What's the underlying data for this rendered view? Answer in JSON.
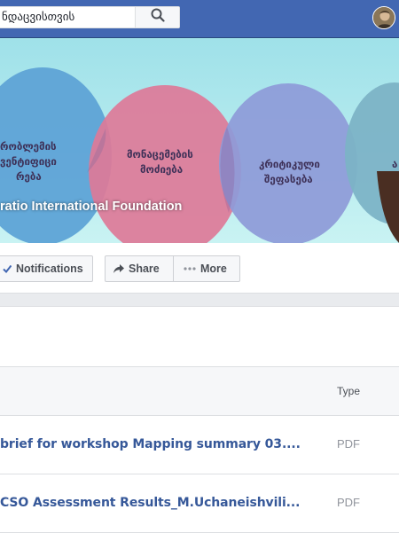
{
  "topbar": {
    "search_value": "ნდაცვისთვის",
    "search_icon": "search-icon",
    "avatar_icon": "user-avatar"
  },
  "cover": {
    "circle_labels": [
      [
        "რობლემის",
        "ვენტიფიცი",
        "რება"
      ],
      [
        "მონაცემების",
        "მოძიება"
      ],
      [
        "კრიტიკული",
        "შეფასება"
      ],
      [
        "ა"
      ]
    ],
    "page_title": "ratio International Foundation"
  },
  "actions": {
    "notifications_label": "Notifications",
    "share_label": "Share",
    "more_label": "More"
  },
  "files": {
    "columns": {
      "type": "Type"
    },
    "rows": [
      {
        "name": "brief for workshop Mapping summary 03....",
        "type": "PDF"
      },
      {
        "name": "CSO Assessment Results_M.Uchaneishvili...",
        "type": "PDF"
      }
    ]
  },
  "colors": {
    "topbar": "#4267b2",
    "link": "#365899",
    "circle_blue": "#5ea3d6",
    "circle_pink": "#dd7a98",
    "circle_periwinkle": "#8e9bd8"
  }
}
